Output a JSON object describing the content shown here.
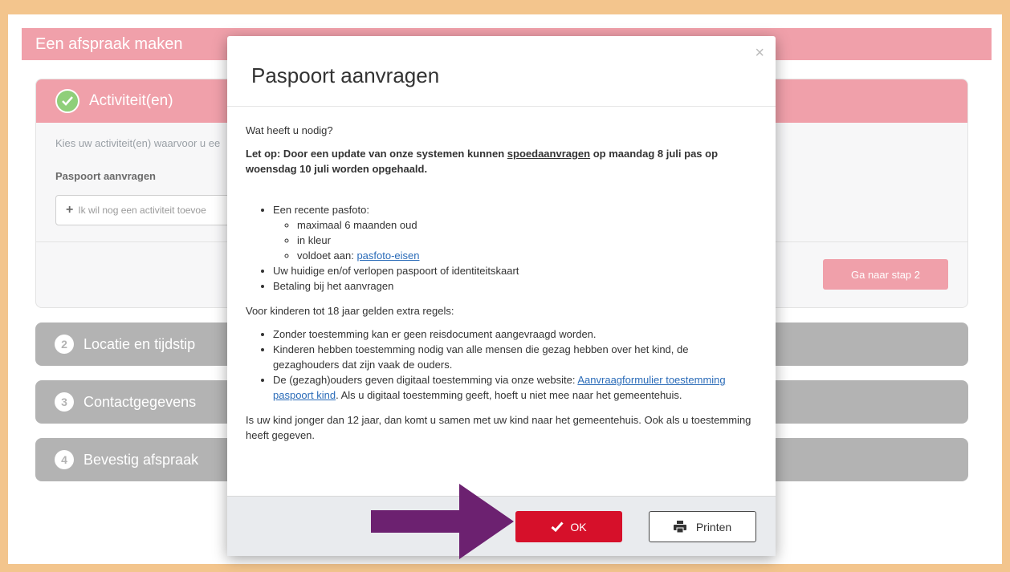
{
  "page": {
    "title": "Een afspraak maken"
  },
  "steps": {
    "active": {
      "title": "Activiteit(en)",
      "hint": "Kies uw activiteit(en) waarvoor u ee",
      "selected_label": "Paspoort aanvragen",
      "add_activity": "Ik wil nog een activiteit toevoe",
      "next_button": "Ga naar stap 2"
    },
    "items": [
      {
        "number": "2",
        "label": "Locatie en tijdstip"
      },
      {
        "number": "3",
        "label": "Contactgegevens"
      },
      {
        "number": "4",
        "label": "Bevestig afspraak"
      }
    ]
  },
  "modal": {
    "title": "Paspoort aanvragen",
    "close_symbol": "×",
    "intro": "Wat heeft u nodig?",
    "notice_prefix": "Let op: Door een update van onze systemen kunnen ",
    "notice_link": "spoedaanvragen",
    "notice_suffix": " op maandag 8 juli pas op woensdag 10 juli worden opgehaald.",
    "needs": {
      "photo": "Een recente pasfoto:",
      "photo_req_1": "maximaal 6 maanden oud",
      "photo_req_2": "in kleur",
      "photo_req_3_prefix": "voldoet aan: ",
      "photo_req_3_link": "pasfoto-eisen",
      "passport": "Uw huidige en/of verlopen paspoort of identiteitskaart",
      "payment": "Betaling bij het aanvragen"
    },
    "children_intro": "Voor kinderen tot 18 jaar gelden extra regels:",
    "children": {
      "rule_1": "Zonder toestemming kan er geen reisdocument aangevraagd worden.",
      "rule_2": "Kinderen hebben toestemming nodig van alle mensen die gezag hebben over het kind, de gezaghouders dat zijn vaak de ouders.",
      "rule_3_prefix": "De (gezagh)ouders geven digitaal toestemming via onze website: ",
      "rule_3_link": "Aanvraagformulier toestemming paspoort kind",
      "rule_3_suffix": ". Als u digitaal toestemming geeft, hoeft u niet mee naar het gemeentehuis."
    },
    "closing": "Is uw kind jonger dan 12 jaar, dan komt u samen met uw kind naar het gemeentehuis. Ook als u toestemming heeft gegeven.",
    "ok_button": "OK",
    "print_button": "Printen"
  },
  "colors": {
    "accent_pink": "#f0a0aa",
    "ok_red": "#d6102a",
    "arrow_purple": "#6c2170",
    "border_orange": "#f3c58d"
  }
}
